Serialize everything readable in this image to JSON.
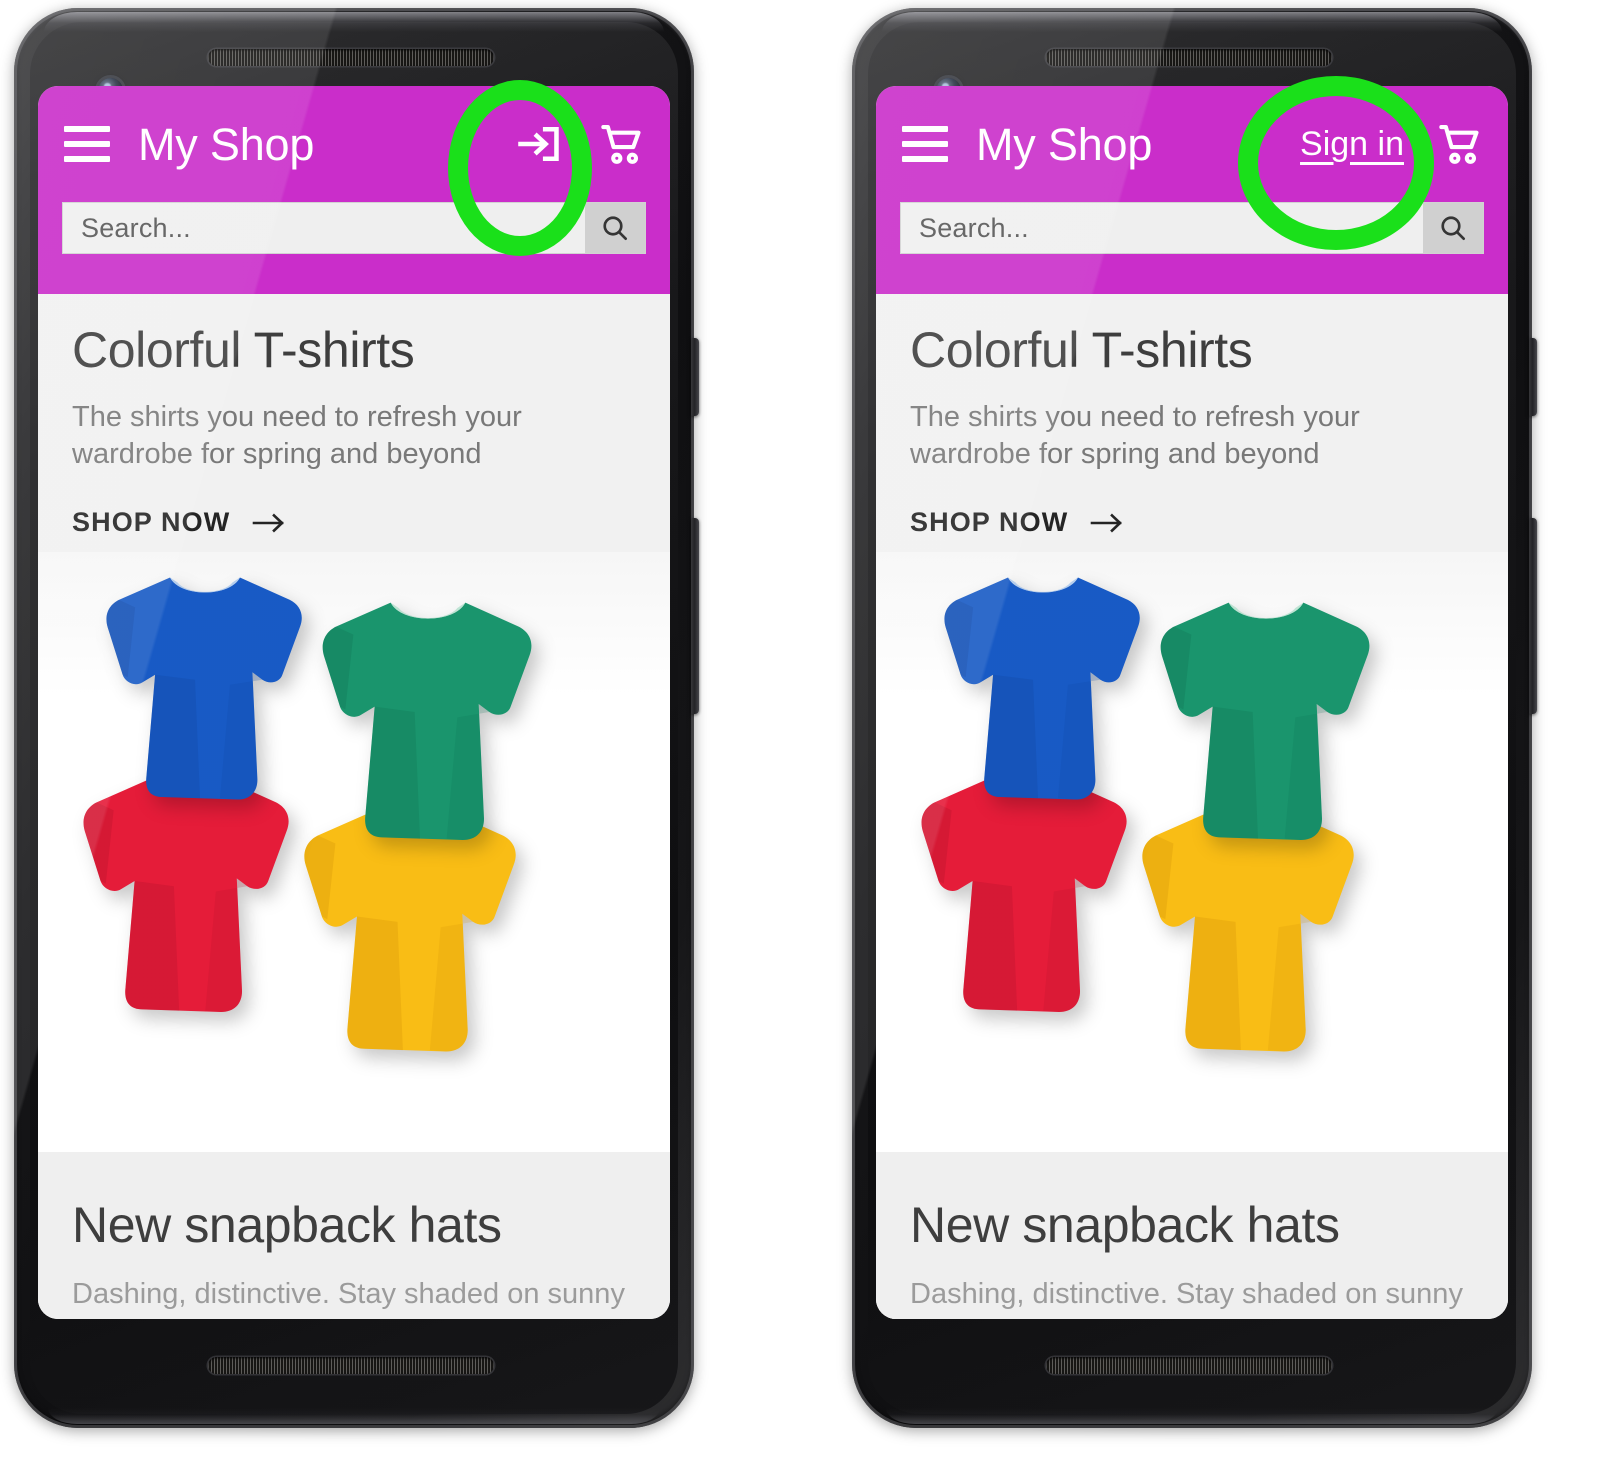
{
  "meta": {
    "screenshot_type": "mobile-app-comparison",
    "annotation_color": "#1ae01a",
    "brand_color": "#c92bc9"
  },
  "phones": [
    {
      "id": "left",
      "appbar": {
        "menu_icon": "hamburger-menu-icon",
        "title": "My Shop",
        "signin_variant": "icon",
        "signin_icon": "login-arrow-icon",
        "signin_label": "",
        "cart_icon": "shopping-cart-icon"
      },
      "search": {
        "placeholder": "Search...",
        "value": "",
        "button_icon": "search-icon"
      },
      "hero": {
        "title": "Colorful T-shirts",
        "subtitle": "The shirts you need to refresh your wardrobe for spring and beyond",
        "cta_label": "SHOP NOW",
        "cta_icon": "arrow-right-icon"
      },
      "photo": {
        "alt": "four folded t-shirts",
        "shirts": [
          {
            "color_name": "blue",
            "hex": "#1558c4"
          },
          {
            "color_name": "green",
            "hex": "#17946b"
          },
          {
            "color_name": "red",
            "hex": "#e51937"
          },
          {
            "color_name": "yellow",
            "hex": "#f9bc12"
          }
        ]
      },
      "section2": {
        "title": "New snapback hats",
        "subtitle": "Dashing, distinctive. Stay shaded on sunny"
      },
      "annotation": {
        "shape": "oval",
        "target": "signin-control"
      }
    },
    {
      "id": "right",
      "appbar": {
        "menu_icon": "hamburger-menu-icon",
        "title": "My Shop",
        "signin_variant": "text",
        "signin_icon": "",
        "signin_label": "Sign in",
        "cart_icon": "shopping-cart-icon"
      },
      "search": {
        "placeholder": "Search...",
        "value": "",
        "button_icon": "search-icon"
      },
      "hero": {
        "title": "Colorful T-shirts",
        "subtitle": "The shirts you need to refresh your wardrobe for spring and beyond",
        "cta_label": "SHOP NOW",
        "cta_icon": "arrow-right-icon"
      },
      "photo": {
        "alt": "four folded t-shirts",
        "shirts": [
          {
            "color_name": "blue",
            "hex": "#1558c4"
          },
          {
            "color_name": "green",
            "hex": "#17946b"
          },
          {
            "color_name": "red",
            "hex": "#e51937"
          },
          {
            "color_name": "yellow",
            "hex": "#f9bc12"
          }
        ]
      },
      "section2": {
        "title": "New snapback hats",
        "subtitle": "Dashing, distinctive. Stay shaded on sunny"
      },
      "annotation": {
        "shape": "circle",
        "target": "signin-control"
      }
    }
  ]
}
